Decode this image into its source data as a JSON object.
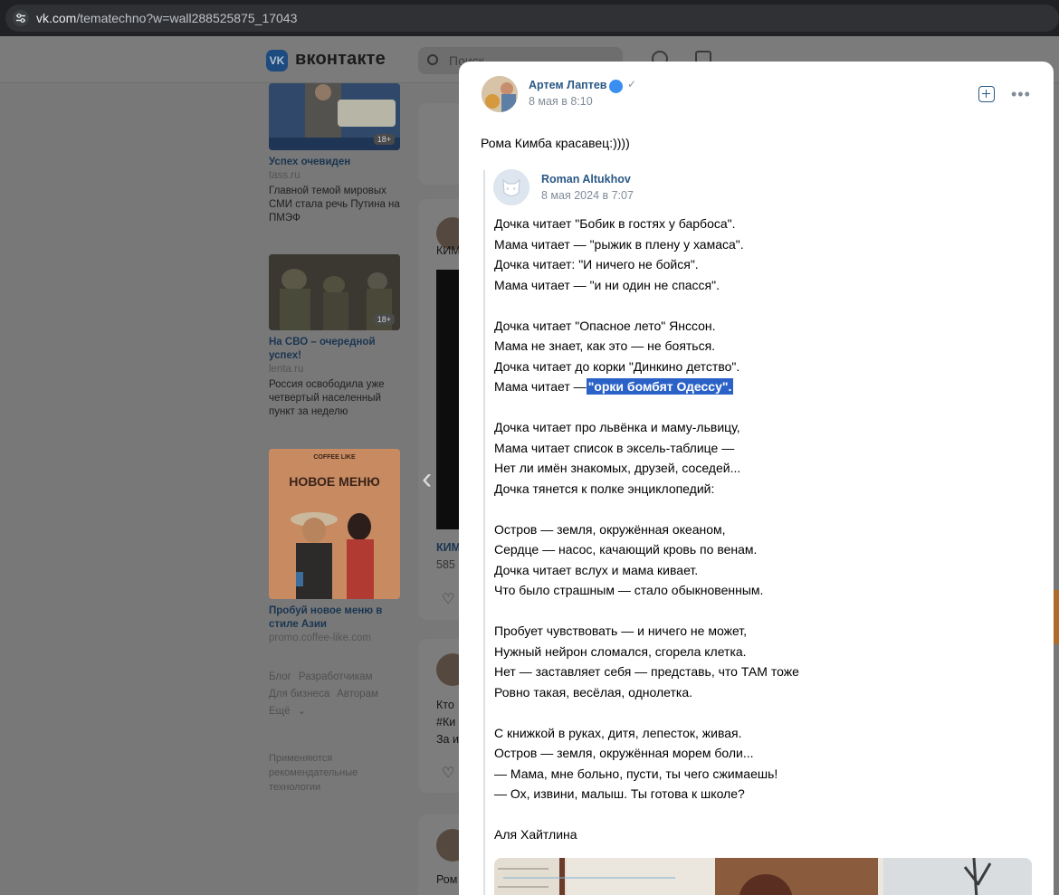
{
  "browser": {
    "url_host": "vk.com",
    "url_path": "/tematechno?w=wall288525875_17043"
  },
  "vk": {
    "logo_letter": "VK",
    "title": "вконтакте",
    "search_placeholder": "Поиск"
  },
  "ads": [
    {
      "title": "Успех очевиден",
      "domain": "tass.ru",
      "text": "Главной темой мировых СМИ стала речь Путина на ПМЭФ",
      "age": "18+"
    },
    {
      "title": "На СВО – очередной успех!",
      "domain": "lenta.ru",
      "text": "Россия освободила уже четвертый населенный пункт за неделю",
      "age": "18+"
    },
    {
      "title": "Пробуй новое меню в стиле Азии",
      "domain": "promo.coffee-like.com",
      "image_brand": "COFFEE LIKE",
      "image_headline": "НОВОЕ МЕНЮ"
    }
  ],
  "footer": {
    "links": [
      "Блог",
      "Разработчикам",
      "Для бизнеса",
      "Авторам",
      "Ещё"
    ],
    "note": "Применяются рекомендательные технологии"
  },
  "feed_fragments": [
    "КИМ",
    "КИМ",
    "585",
    "Кто",
    "#Ки",
    "За и",
    "Ром"
  ],
  "post": {
    "author": "Артем Лаптев",
    "date": "8 мая в 8:10",
    "text": "Рома Кимба красавец:))))"
  },
  "repost": {
    "author": "Roman Altukhov",
    "date": "8 мая 2024 в 7:07"
  },
  "poem": {
    "stanza1": [
      "Дочка читает \"Бобик в гостях у барбоса\".",
      "Мама читает — \"рыжик в плену у хамаса\".",
      "Дочка читает: \"И ничего не бойся\".",
      "Мама читает — \"и ни один не спасся\"."
    ],
    "stanza2": [
      "Дочка читает \"Опасное лето\" Янссон.",
      "Мама не знает, как это — не бояться.",
      "Дочка читает до корки \"Динкино детство\"."
    ],
    "highlight_prefix": "Мама читает —",
    "highlight_text": "\"орки бомбят Одессу\".",
    "stanza3": [
      "Дочка читает про львёнка и маму-львицу,",
      "Мама читает список в эксель-таблице —",
      "Нет ли имён знакомых, друзей, соседей...",
      "Дочка тянется к полке энциклопедий:"
    ],
    "stanza4": [
      "Остров — земля, окружённая океаном,",
      "Сердце — насос, качающий кровь по венам.",
      "Дочка читает вслух и мама кивает.",
      "Что было страшным — стало обыкновенным."
    ],
    "stanza5": [
      "Пробует чувствовать — и ничего не может,",
      "Нужный нейрон сломался, сгорела клетка.",
      "Нет — заставляет себя — представь, что ТАМ тоже",
      "Ровно такая, весёлая, однолетка."
    ],
    "stanza6": [
      "С книжкой в руках, дитя, лепесток, живая.",
      "Остров — земля, окружённая морем боли...",
      "— Мама, мне больно, пусти, ты чего сжимаешь!",
      "— Ох, извини, малыш. Ты готова к школе?"
    ],
    "signature": "Аля Хайтлина"
  },
  "colors": {
    "link": "#2a5885",
    "secondary": "#818c99",
    "highlight": "#2b62c7"
  }
}
